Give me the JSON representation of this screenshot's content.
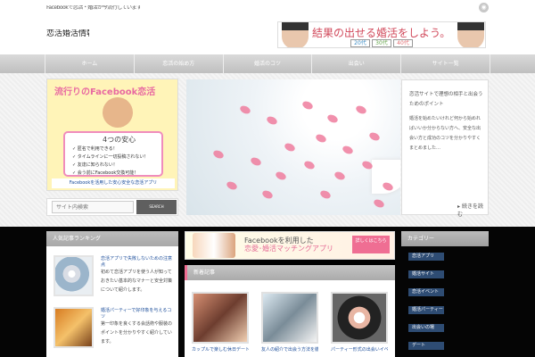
{
  "header": {
    "tagline": "Facebookで恋活・婚活が今流行しています",
    "logo": "恋活婚活情報局"
  },
  "banner": {
    "headline_prefix": "結果の出せる",
    "headline_accent": "婚活",
    "headline_suffix": "をしよう。",
    "ages": [
      "20代",
      "30代",
      "40代"
    ]
  },
  "nav": {
    "items": [
      "ホーム",
      "恋活の始め方",
      "婚活のコツ",
      "出会い",
      "サイト一覧"
    ]
  },
  "fbad": {
    "title": "流行りのFacebook恋活",
    "safe_title": "4つの安心",
    "points": [
      "✓ 匿名で利用できる！",
      "✓ タイムラインに一切投稿されない！",
      "✓ 友達に知られない！",
      "✓ 会う前にFacebook交換可能！"
    ],
    "bottom": "Facebookを活用した安心安全な恋活アプリ"
  },
  "search": {
    "placeholder": "サイト内検索",
    "button": "SEARCH"
  },
  "hero": {
    "title": "恋活サイトで理想の相手と出会うためのポイント",
    "body": "婚活を始めたいけれど何から始めればいいか分からない方へ、安全な出会い方と成功のコツを分かりやすくまとめました…",
    "more": "続きを読む"
  },
  "sidebar_left": {
    "heading": "人気記事ランキング",
    "articles": [
      {
        "title": "恋活アプリで失敗しないための注意点",
        "text": "初めて恋活アプリを使う人が知っておきたい基本的なマナーと安全対策について紹介します。"
      },
      {
        "title": "婚活パーティーで好印象を与えるコツ",
        "text": "第一印象を良くする会話術や服装のポイントを分かりやすく紹介しています。"
      }
    ]
  },
  "ad2": {
    "line1": "Facebookを利用した",
    "line2": "恋愛･婚活マッチングアプリ",
    "button": "詳しくはこちら"
  },
  "middle": {
    "heading": "新着記事",
    "posts": [
      "カップルで楽しむ休日デートの過ごし方",
      "友人の紹介で出会う方法を徹底解説",
      "パーティー形式の出会いイベント"
    ]
  },
  "sidebar_right": {
    "heading": "カテゴリー",
    "categories": [
      "恋活アプリ",
      "婚活サイト",
      "恋活イベント",
      "婚活パーティー",
      "出会いの場",
      "デート"
    ]
  }
}
